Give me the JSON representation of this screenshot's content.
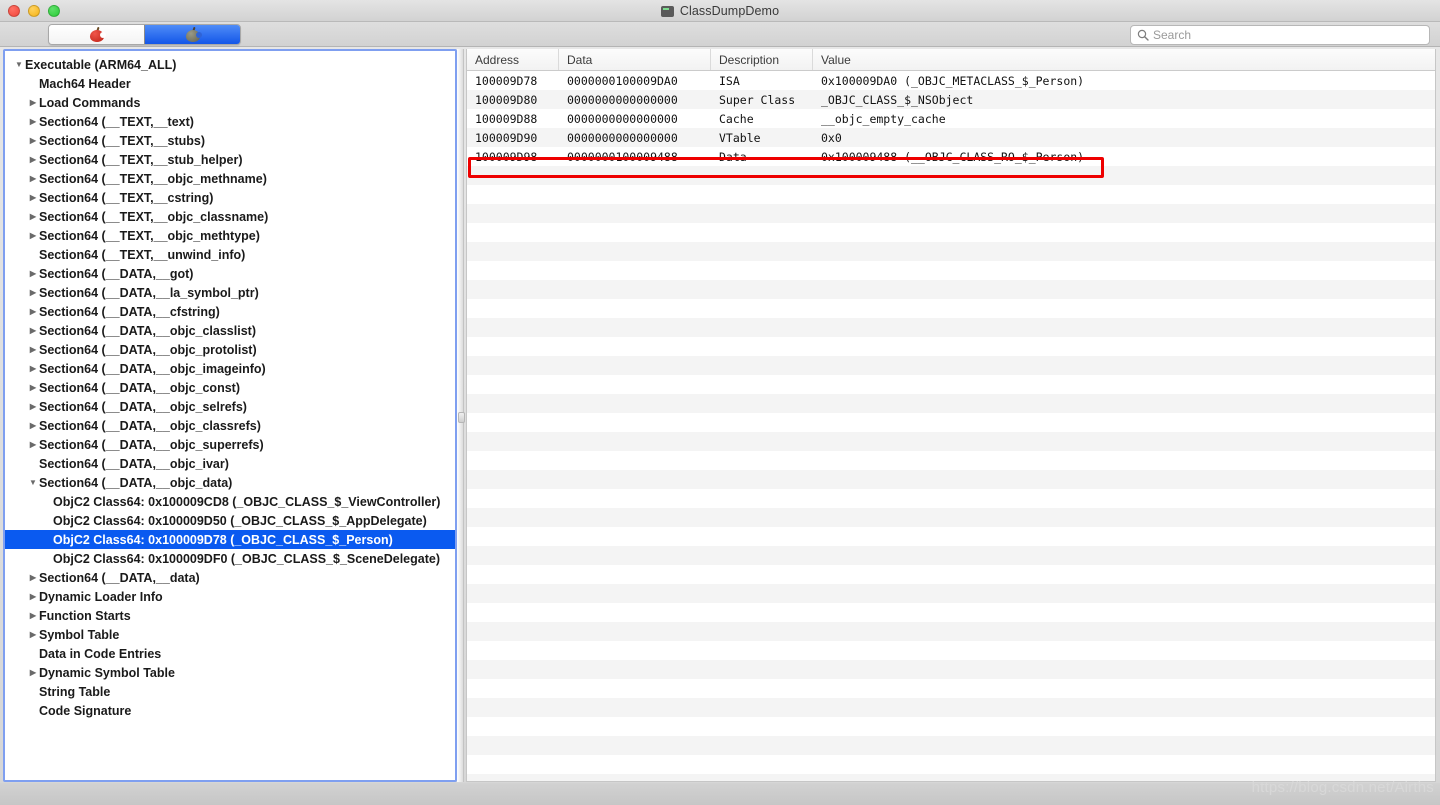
{
  "window": {
    "title": "ClassDumpDemo",
    "title_icon": "display-icon",
    "traffic_lights": [
      "close-button",
      "minimize-button",
      "zoom-button"
    ]
  },
  "toolbar": {
    "segmented_control": {
      "segments": [
        {
          "icon": "red-apple-icon",
          "selected": false
        },
        {
          "icon": "gray-apple-icon",
          "selected": true
        }
      ]
    },
    "search": {
      "icon": "search-icon",
      "placeholder": "Search",
      "value": ""
    }
  },
  "sidebar": {
    "items": [
      {
        "label": "Executable  (ARM64_ALL)",
        "indent": 0,
        "twisty": "down",
        "selected": false
      },
      {
        "label": "Mach64 Header",
        "indent": 1,
        "twisty": "none",
        "selected": false
      },
      {
        "label": "Load Commands",
        "indent": 1,
        "twisty": "right",
        "selected": false
      },
      {
        "label": "Section64 (__TEXT,__text)",
        "indent": 1,
        "twisty": "right",
        "selected": false
      },
      {
        "label": "Section64 (__TEXT,__stubs)",
        "indent": 1,
        "twisty": "right",
        "selected": false
      },
      {
        "label": "Section64 (__TEXT,__stub_helper)",
        "indent": 1,
        "twisty": "right",
        "selected": false
      },
      {
        "label": "Section64 (__TEXT,__objc_methname)",
        "indent": 1,
        "twisty": "right",
        "selected": false
      },
      {
        "label": "Section64 (__TEXT,__cstring)",
        "indent": 1,
        "twisty": "right",
        "selected": false
      },
      {
        "label": "Section64 (__TEXT,__objc_classname)",
        "indent": 1,
        "twisty": "right",
        "selected": false
      },
      {
        "label": "Section64 (__TEXT,__objc_methtype)",
        "indent": 1,
        "twisty": "right",
        "selected": false
      },
      {
        "label": "Section64 (__TEXT,__unwind_info)",
        "indent": 1,
        "twisty": "none",
        "selected": false
      },
      {
        "label": "Section64 (__DATA,__got)",
        "indent": 1,
        "twisty": "right",
        "selected": false
      },
      {
        "label": "Section64 (__DATA,__la_symbol_ptr)",
        "indent": 1,
        "twisty": "right",
        "selected": false
      },
      {
        "label": "Section64 (__DATA,__cfstring)",
        "indent": 1,
        "twisty": "right",
        "selected": false
      },
      {
        "label": "Section64 (__DATA,__objc_classlist)",
        "indent": 1,
        "twisty": "right",
        "selected": false
      },
      {
        "label": "Section64 (__DATA,__objc_protolist)",
        "indent": 1,
        "twisty": "right",
        "selected": false
      },
      {
        "label": "Section64 (__DATA,__objc_imageinfo)",
        "indent": 1,
        "twisty": "right",
        "selected": false
      },
      {
        "label": "Section64 (__DATA,__objc_const)",
        "indent": 1,
        "twisty": "right",
        "selected": false
      },
      {
        "label": "Section64 (__DATA,__objc_selrefs)",
        "indent": 1,
        "twisty": "right",
        "selected": false
      },
      {
        "label": "Section64 (__DATA,__objc_classrefs)",
        "indent": 1,
        "twisty": "right",
        "selected": false
      },
      {
        "label": "Section64 (__DATA,__objc_superrefs)",
        "indent": 1,
        "twisty": "right",
        "selected": false
      },
      {
        "label": "Section64 (__DATA,__objc_ivar)",
        "indent": 1,
        "twisty": "none",
        "selected": false
      },
      {
        "label": "Section64 (__DATA,__objc_data)",
        "indent": 1,
        "twisty": "down",
        "selected": false
      },
      {
        "label": "ObjC2 Class64: 0x100009CD8 (_OBJC_CLASS_$_ViewController)",
        "indent": 2,
        "twisty": "none",
        "selected": false
      },
      {
        "label": "ObjC2 Class64: 0x100009D50 (_OBJC_CLASS_$_AppDelegate)",
        "indent": 2,
        "twisty": "none",
        "selected": false
      },
      {
        "label": "ObjC2 Class64: 0x100009D78 (_OBJC_CLASS_$_Person)",
        "indent": 2,
        "twisty": "none",
        "selected": true
      },
      {
        "label": "ObjC2 Class64: 0x100009DF0 (_OBJC_CLASS_$_SceneDelegate)",
        "indent": 2,
        "twisty": "none",
        "selected": false
      },
      {
        "label": "Section64 (__DATA,__data)",
        "indent": 1,
        "twisty": "right",
        "selected": false
      },
      {
        "label": "Dynamic Loader Info",
        "indent": 1,
        "twisty": "right",
        "selected": false
      },
      {
        "label": "Function Starts",
        "indent": 1,
        "twisty": "right",
        "selected": false
      },
      {
        "label": "Symbol Table",
        "indent": 1,
        "twisty": "right",
        "selected": false
      },
      {
        "label": "Data in Code Entries",
        "indent": 1,
        "twisty": "none",
        "selected": false
      },
      {
        "label": "Dynamic Symbol Table",
        "indent": 1,
        "twisty": "right",
        "selected": false
      },
      {
        "label": "String Table",
        "indent": 1,
        "twisty": "none",
        "selected": false
      },
      {
        "label": "Code Signature",
        "indent": 1,
        "twisty": "none",
        "selected": false
      }
    ]
  },
  "table": {
    "columns": [
      "Address",
      "Data",
      "Description",
      "Value"
    ],
    "rows": [
      {
        "address": "100009D78",
        "data": "0000000100009DA0",
        "description": "ISA",
        "value": "0x100009DA0 (_OBJC_METACLASS_$_Person)",
        "highlighted": false
      },
      {
        "address": "100009D80",
        "data": "0000000000000000",
        "description": "Super Class",
        "value": "_OBJC_CLASS_$_NSObject",
        "highlighted": false
      },
      {
        "address": "100009D88",
        "data": "0000000000000000",
        "description": "Cache",
        "value": "__objc_empty_cache",
        "highlighted": false
      },
      {
        "address": "100009D90",
        "data": "0000000000000000",
        "description": "VTable",
        "value": "0x0",
        "highlighted": false
      },
      {
        "address": "100009D98",
        "data": "0000000100009488",
        "description": "Data",
        "value": "0x100009488 (__OBJC_CLASS_RO_$_Person)",
        "highlighted": true
      }
    ],
    "empty_row_count": 33
  },
  "watermark": {
    "text": "https://blog.csdn.net/Airths"
  },
  "colors": {
    "selection_blue": "#0a5af0",
    "focus_ring": "#7f9ff0",
    "highlight_red": "#ee0000",
    "row_stripe": "#f4f4f4"
  }
}
